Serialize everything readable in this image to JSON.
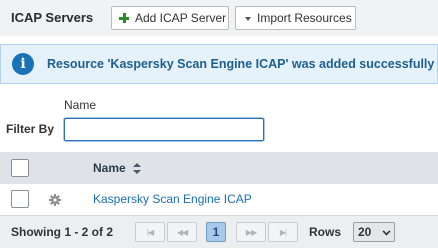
{
  "toolbar": {
    "title": "ICAP Servers",
    "add_label": "Add ICAP Server",
    "import_label": "Import Resources",
    "add_icon": "plus-icon",
    "import_icon": "caret-down-icon"
  },
  "alert": {
    "icon": "info-icon",
    "message": "Resource 'Kaspersky Scan Engine ICAP' was added successfully"
  },
  "filter": {
    "column_label": "Name",
    "label": "Filter By",
    "value": ""
  },
  "table": {
    "columns": [
      "Name"
    ],
    "rows": [
      {
        "name": "Kaspersky Scan Engine ICAP",
        "icon": "gear-icon"
      }
    ]
  },
  "pager": {
    "summary": "Showing 1 - 2 of 2",
    "current_page": "1",
    "rows_label": "Rows",
    "rows_value": "20"
  },
  "colors": {
    "toolbar_bg": "#f1f2f3",
    "alert_bg": "#e5f1fb",
    "alert_text": "#1f5f8f",
    "link": "#1a6fb3",
    "header_bg": "#dfe3e8"
  }
}
